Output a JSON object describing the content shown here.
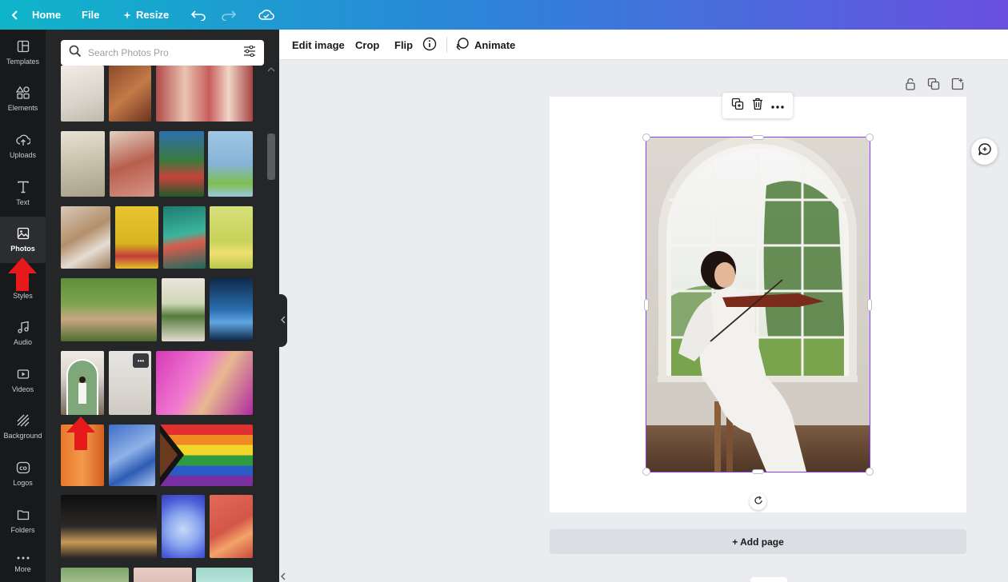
{
  "topbar": {
    "home_label": "Home",
    "file_label": "File",
    "resize_label": "Resize",
    "icons": [
      "chevron-left-icon",
      "sparkle-icon",
      "undo-icon",
      "redo-icon",
      "cloud-sync-icon"
    ]
  },
  "rail": {
    "items": [
      {
        "label": "Templates",
        "icon": "templates-icon"
      },
      {
        "label": "Elements",
        "icon": "elements-icon"
      },
      {
        "label": "Uploads",
        "icon": "uploads-icon"
      },
      {
        "label": "Text",
        "icon": "text-icon"
      },
      {
        "label": "Photos",
        "icon": "photos-icon",
        "active": true
      },
      {
        "label": "Styles",
        "icon": "styles-icon"
      },
      {
        "label": "Audio",
        "icon": "audio-icon"
      },
      {
        "label": "Videos",
        "icon": "videos-icon"
      },
      {
        "label": "Background",
        "icon": "background-icon"
      },
      {
        "label": "Logos",
        "icon": "logos-icon"
      },
      {
        "label": "Folders",
        "icon": "folders-icon"
      },
      {
        "label": "More",
        "icon": "more-icon"
      }
    ]
  },
  "panel": {
    "search_placeholder": "Search Photos Pro",
    "thumb_more_label": "•••"
  },
  "toolbar": {
    "edit_image": "Edit image",
    "crop": "Crop",
    "flip": "Flip",
    "animate": "Animate"
  },
  "canvas": {
    "add_page_label": "+ Add page"
  },
  "colors": {
    "accent": "#8b3dff",
    "topbar_start": "#0fb5c9",
    "topbar_end": "#6a4fe0",
    "arrow": "#e8191b"
  }
}
